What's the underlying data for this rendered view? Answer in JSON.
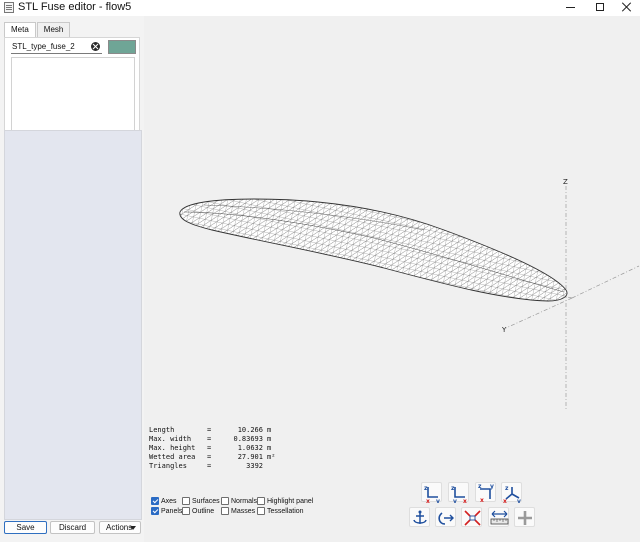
{
  "window": {
    "title": "STL Fuse editor - flow5"
  },
  "tabs": [
    {
      "label": "Meta"
    },
    {
      "label": "Mesh"
    }
  ],
  "meta": {
    "name_value": "STL_type_fuse_2",
    "color": "#6fa596",
    "description": ""
  },
  "buttons": {
    "save": "Save",
    "discard": "Discard",
    "actions": "Actions"
  },
  "stats": [
    {
      "label": "Length",
      "value": "10.266",
      "unit": "m"
    },
    {
      "label": "Max. width",
      "value": "0.83693",
      "unit": "m"
    },
    {
      "label": "Max. height",
      "value": "1.0632",
      "unit": "m"
    },
    {
      "label": "Wetted area",
      "value": "27.901",
      "unit": "m²"
    },
    {
      "label": "Triangles",
      "value": "3392",
      "unit": ""
    }
  ],
  "axes_labels": {
    "z": "Z",
    "y": "Y",
    "x": "X"
  },
  "toggles": {
    "axes": {
      "label": "Axes",
      "checked": true
    },
    "surfaces": {
      "label": "Surfaces",
      "checked": false
    },
    "normals": {
      "label": "Normals",
      "checked": false
    },
    "highlight_panel": {
      "label": "Highlight panel",
      "checked": false
    },
    "panels": {
      "label": "Panels",
      "checked": true
    },
    "outline": {
      "label": "Outline",
      "checked": false
    },
    "masses": {
      "label": "Masses",
      "checked": false
    },
    "tessellation": {
      "label": "Tessellation",
      "checked": false
    }
  },
  "view_buttons": {
    "xy": {
      "a": "z",
      "b": "x",
      "c": "y"
    },
    "yz": {
      "a": "z",
      "b": "y",
      "c": "x"
    },
    "xz": {
      "a": "z",
      "b": "y",
      "c": "x"
    },
    "iso": {
      "a": "z",
      "b": "x",
      "c": "y"
    }
  },
  "colors": {
    "accent": "#2a6bc4",
    "mesh": "#555555",
    "axis_red": "#d42020",
    "axis_blue": "#1f4f9e"
  }
}
